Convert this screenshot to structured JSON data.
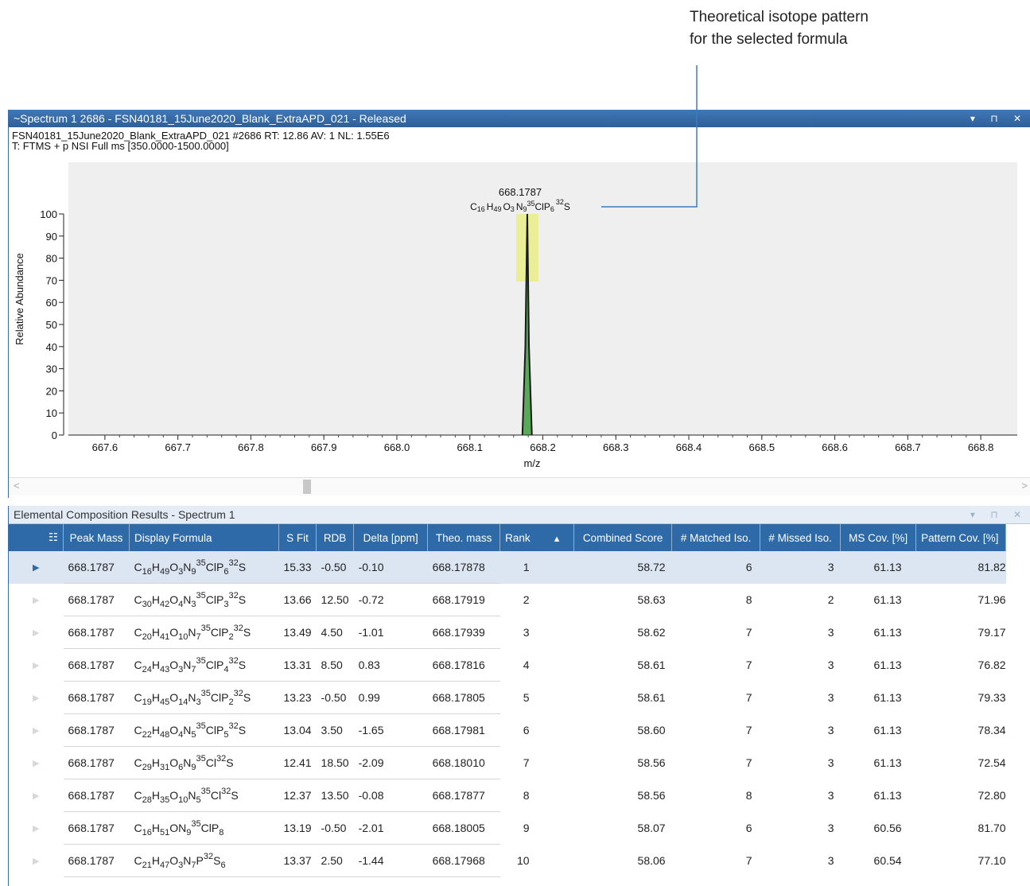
{
  "callout": {
    "line1": "Theoretical isotope pattern",
    "line2": "for the selected formula"
  },
  "spectrum_panel": {
    "title": "~Spectrum  1  2686 - FSN40181_15June2020_Blank_ExtraAPD_021 - Released",
    "controls": "▾ ⊓ ✕",
    "info_line1": "FSN40181_15June2020_Blank_ExtraAPD_021 #2686 RT: 12.86 AV: 1 NL: 1.55E6",
    "info_line2": "T: FTMS + p NSI Full ms [350.0000-1500.0000]",
    "peak_mass": "668.1787",
    "peak_formula": "C16 H49 O3 N9 35ClP6 32S",
    "peak_label_sub": {
      "C": "16",
      "H": "49",
      "O": "3",
      "N": "9",
      "iso1": "35",
      "mid": "ClP",
      "P": "6",
      "iso2": "32",
      "end": "S"
    },
    "scroll_left": "<",
    "scroll_right": ">"
  },
  "chart_data": {
    "type": "line",
    "xlabel": "m/z",
    "ylabel": "Relative Abundance",
    "xlim": [
      667.55,
      668.85
    ],
    "ylim": [
      0,
      100
    ],
    "x_ticks": [
      "667.6",
      "667.7",
      "667.8",
      "667.9",
      "668.0",
      "668.1",
      "668.2",
      "668.3",
      "668.4",
      "668.5",
      "668.6",
      "668.7",
      "668.8"
    ],
    "y_ticks": [
      "0",
      "10",
      "20",
      "30",
      "40",
      "50",
      "60",
      "70",
      "80",
      "90",
      "100"
    ],
    "series": [
      {
        "x": [
          668.172,
          668.176,
          668.1787,
          668.181,
          668.185
        ],
        "y": [
          0,
          40,
          100,
          40,
          0
        ]
      }
    ],
    "colors": {
      "measured": "#1a1a1a",
      "theoretical_fill": "#5aa85a",
      "highlight": "#e8ee80"
    }
  },
  "results_panel": {
    "title": "Elemental Composition Results  - Spectrum 1",
    "controls": "▾ ⊓ ✕",
    "columns": [
      "Peak Mass",
      "Display Formula",
      "S Fit",
      "RDB",
      "Delta [ppm]",
      "Theo. mass",
      "Rank",
      "Combined Score",
      "# Matched Iso.",
      "# Missed Iso.",
      "MS Cov. [%]",
      "Pattern Cov. [%]"
    ],
    "sort_indicator": "▲",
    "rows": [
      {
        "peak": "668.1787",
        "f": [
          [
            "C",
            "16"
          ],
          [
            "H",
            "49"
          ],
          [
            "O",
            "3"
          ],
          [
            "N",
            "9"
          ],
          [
            "^35",
            ""
          ],
          [
            "ClP",
            "6"
          ],
          [
            "^32",
            ""
          ],
          [
            "S",
            ""
          ]
        ],
        "sfit": "15.33",
        "rdb": "-0.50",
        "delta": "-0.10",
        "theo": "668.17878",
        "rank": "1",
        "score": "58.72",
        "matched": "6",
        "missed": "3",
        "mscov": "61.13",
        "patcov": "81.82"
      },
      {
        "peak": "668.1787",
        "f": [
          [
            "C",
            "30"
          ],
          [
            "H",
            "42"
          ],
          [
            "O",
            "4"
          ],
          [
            "N",
            "3"
          ],
          [
            "^35",
            ""
          ],
          [
            "ClP",
            "3"
          ],
          [
            "^32",
            ""
          ],
          [
            "S",
            ""
          ]
        ],
        "sfit": "13.66",
        "rdb": "12.50",
        "delta": "-0.72",
        "theo": "668.17919",
        "rank": "2",
        "score": "58.63",
        "matched": "8",
        "missed": "2",
        "mscov": "61.13",
        "patcov": "71.96"
      },
      {
        "peak": "668.1787",
        "f": [
          [
            "C",
            "20"
          ],
          [
            "H",
            "41"
          ],
          [
            "O",
            "10"
          ],
          [
            "N",
            "7"
          ],
          [
            "^35",
            ""
          ],
          [
            "ClP",
            "2"
          ],
          [
            "^32",
            ""
          ],
          [
            "S",
            ""
          ]
        ],
        "sfit": "13.49",
        "rdb": "4.50",
        "delta": "-1.01",
        "theo": "668.17939",
        "rank": "3",
        "score": "58.62",
        "matched": "7",
        "missed": "3",
        "mscov": "61.13",
        "patcov": "79.17"
      },
      {
        "peak": "668.1787",
        "f": [
          [
            "C",
            "24"
          ],
          [
            "H",
            "43"
          ],
          [
            "O",
            "3"
          ],
          [
            "N",
            "7"
          ],
          [
            "^35",
            ""
          ],
          [
            "ClP",
            "4"
          ],
          [
            "^32",
            ""
          ],
          [
            "S",
            ""
          ]
        ],
        "sfit": "13.31",
        "rdb": "8.50",
        "delta": "0.83",
        "theo": "668.17816",
        "rank": "4",
        "score": "58.61",
        "matched": "7",
        "missed": "3",
        "mscov": "61.13",
        "patcov": "76.82"
      },
      {
        "peak": "668.1787",
        "f": [
          [
            "C",
            "19"
          ],
          [
            "H",
            "45"
          ],
          [
            "O",
            "14"
          ],
          [
            "N",
            "3"
          ],
          [
            "^35",
            ""
          ],
          [
            "ClP",
            "2"
          ],
          [
            "^32",
            ""
          ],
          [
            "S",
            ""
          ]
        ],
        "sfit": "13.23",
        "rdb": "-0.50",
        "delta": "0.99",
        "theo": "668.17805",
        "rank": "5",
        "score": "58.61",
        "matched": "7",
        "missed": "3",
        "mscov": "61.13",
        "patcov": "79.33"
      },
      {
        "peak": "668.1787",
        "f": [
          [
            "C",
            "22"
          ],
          [
            "H",
            "48"
          ],
          [
            "O",
            "4"
          ],
          [
            "N",
            "5"
          ],
          [
            "^35",
            ""
          ],
          [
            "ClP",
            "5"
          ],
          [
            "^32",
            ""
          ],
          [
            "S",
            ""
          ]
        ],
        "sfit": "13.04",
        "rdb": "3.50",
        "delta": "-1.65",
        "theo": "668.17981",
        "rank": "6",
        "score": "58.60",
        "matched": "7",
        "missed": "3",
        "mscov": "61.13",
        "patcov": "78.34"
      },
      {
        "peak": "668.1787",
        "f": [
          [
            "C",
            "29"
          ],
          [
            "H",
            "31"
          ],
          [
            "O",
            "6"
          ],
          [
            "N",
            "9"
          ],
          [
            "^35",
            ""
          ],
          [
            "Cl",
            ""
          ],
          [
            "^32",
            ""
          ],
          [
            "S",
            ""
          ]
        ],
        "sfit": "12.41",
        "rdb": "18.50",
        "delta": "-2.09",
        "theo": "668.18010",
        "rank": "7",
        "score": "58.56",
        "matched": "7",
        "missed": "3",
        "mscov": "61.13",
        "patcov": "72.54"
      },
      {
        "peak": "668.1787",
        "f": [
          [
            "C",
            "28"
          ],
          [
            "H",
            "35"
          ],
          [
            "O",
            "10"
          ],
          [
            "N",
            "5"
          ],
          [
            "^35",
            ""
          ],
          [
            "Cl",
            ""
          ],
          [
            "^32",
            ""
          ],
          [
            "S",
            ""
          ]
        ],
        "sfit": "12.37",
        "rdb": "13.50",
        "delta": "-0.08",
        "theo": "668.17877",
        "rank": "8",
        "score": "58.56",
        "matched": "8",
        "missed": "3",
        "mscov": "61.13",
        "patcov": "72.80"
      },
      {
        "peak": "668.1787",
        "f": [
          [
            "C",
            "16"
          ],
          [
            "H",
            "51"
          ],
          [
            "O",
            ""
          ],
          [
            "N",
            "9"
          ],
          [
            "^35",
            ""
          ],
          [
            "ClP",
            "8"
          ]
        ],
        "sfit": "13.19",
        "rdb": "-0.50",
        "delta": "-2.01",
        "theo": "668.18005",
        "rank": "9",
        "score": "58.07",
        "matched": "6",
        "missed": "3",
        "mscov": "60.56",
        "patcov": "81.70"
      },
      {
        "peak": "668.1787",
        "f": [
          [
            "C",
            "21"
          ],
          [
            "H",
            "47"
          ],
          [
            "O",
            "3"
          ],
          [
            "N",
            "7"
          ],
          [
            "P",
            ""
          ],
          [
            "^32",
            ""
          ],
          [
            "S",
            "6"
          ]
        ],
        "sfit": "13.37",
        "rdb": "2.50",
        "delta": "-1.44",
        "theo": "668.17968",
        "rank": "10",
        "score": "58.06",
        "matched": "7",
        "missed": "3",
        "mscov": "60.54",
        "patcov": "77.10"
      }
    ]
  }
}
